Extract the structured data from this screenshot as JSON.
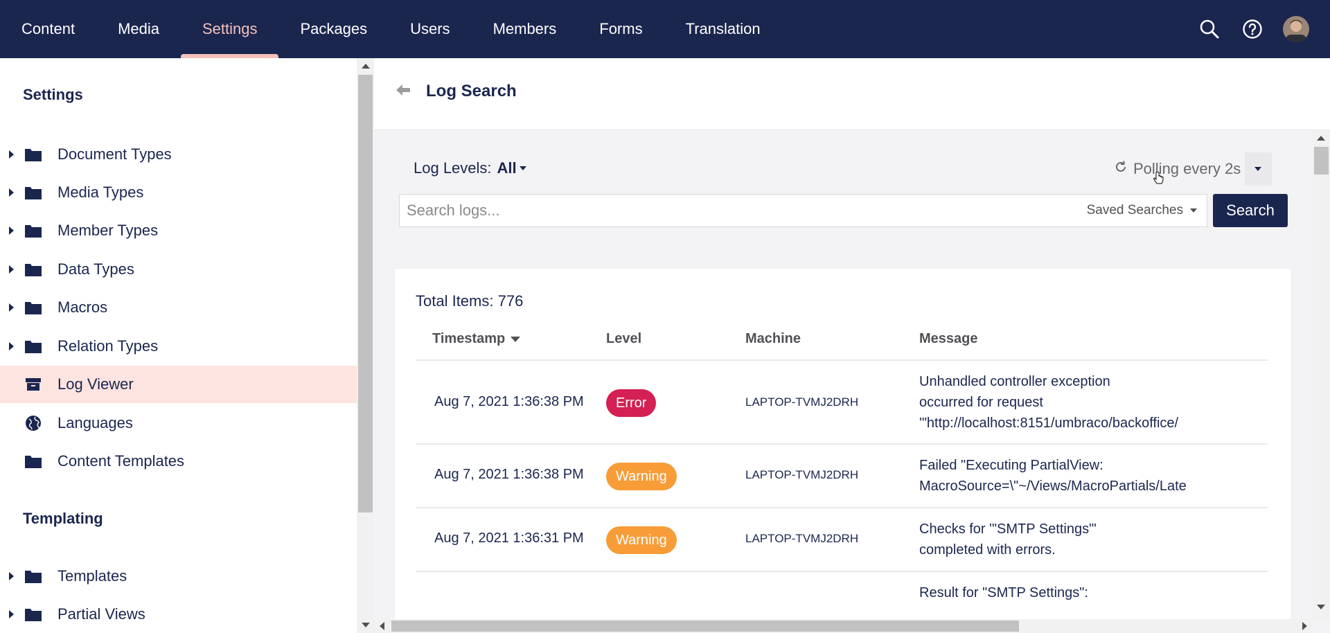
{
  "nav": {
    "items": [
      {
        "label": "Content",
        "active": false
      },
      {
        "label": "Media",
        "active": false
      },
      {
        "label": "Settings",
        "active": true
      },
      {
        "label": "Packages",
        "active": false
      },
      {
        "label": "Users",
        "active": false
      },
      {
        "label": "Members",
        "active": false
      },
      {
        "label": "Forms",
        "active": false
      },
      {
        "label": "Translation",
        "active": false
      }
    ],
    "icons": [
      "search-icon",
      "help-icon",
      "avatar"
    ]
  },
  "sidebar": {
    "settings_title": "Settings",
    "settings_items": [
      {
        "label": "Document Types",
        "icon": "folder-icon",
        "expandable": true
      },
      {
        "label": "Media Types",
        "icon": "folder-icon",
        "expandable": true
      },
      {
        "label": "Member Types",
        "icon": "folder-icon",
        "expandable": true
      },
      {
        "label": "Data Types",
        "icon": "folder-icon",
        "expandable": true
      },
      {
        "label": "Macros",
        "icon": "folder-icon",
        "expandable": true
      },
      {
        "label": "Relation Types",
        "icon": "folder-icon",
        "expandable": true
      },
      {
        "label": "Log Viewer",
        "icon": "archive-icon",
        "expandable": false,
        "selected": true
      },
      {
        "label": "Languages",
        "icon": "globe-icon",
        "expandable": false
      },
      {
        "label": "Content Templates",
        "icon": "folder-icon",
        "expandable": false
      }
    ],
    "templating_title": "Templating",
    "templating_items": [
      {
        "label": "Templates",
        "icon": "folder-icon",
        "expandable": true
      },
      {
        "label": "Partial Views",
        "icon": "folder-icon",
        "expandable": true
      }
    ]
  },
  "main": {
    "title": "Log Search",
    "log_levels_label": "Log Levels:",
    "log_levels_value": "All",
    "polling_label": "Polling every 2s",
    "search": {
      "placeholder": "Search logs...",
      "value": ""
    },
    "saved_searches_label": "Saved Searches",
    "search_button": "Search",
    "total_items": "Total Items: 776",
    "table": {
      "columns": [
        "Timestamp",
        "Level",
        "Machine",
        "Message"
      ],
      "rows": [
        {
          "timestamp": "Aug 7, 2021 1:36:38 PM",
          "level": "Error",
          "machine": "LAPTOP-TVMJ2DRH",
          "message": "Unhandled controller exception\noccurred for request\n'\"http://localhost:8151/umbraco/backoffice/"
        },
        {
          "timestamp": "Aug 7, 2021 1:36:38 PM",
          "level": "Warning",
          "machine": "LAPTOP-TVMJ2DRH",
          "message": "Failed \"Executing PartialView:\nMacroSource=\\\"~/Views/MacroPartials/Late"
        },
        {
          "timestamp": "Aug 7, 2021 1:36:31 PM",
          "level": "Warning",
          "machine": "LAPTOP-TVMJ2DRH",
          "message": "Checks for '\"SMTP Settings\"'\ncompleted with errors."
        },
        {
          "timestamp": "",
          "level": "",
          "machine": "",
          "message": "Result for \"SMTP Settings\":"
        }
      ]
    }
  },
  "colors": {
    "nav_bg": "#1b264f",
    "nav_active": "#f5c1bc",
    "selected_bg": "#fde4e0",
    "error": "#d42054",
    "warning": "#f79c37",
    "primary_button": "#1b264f"
  }
}
